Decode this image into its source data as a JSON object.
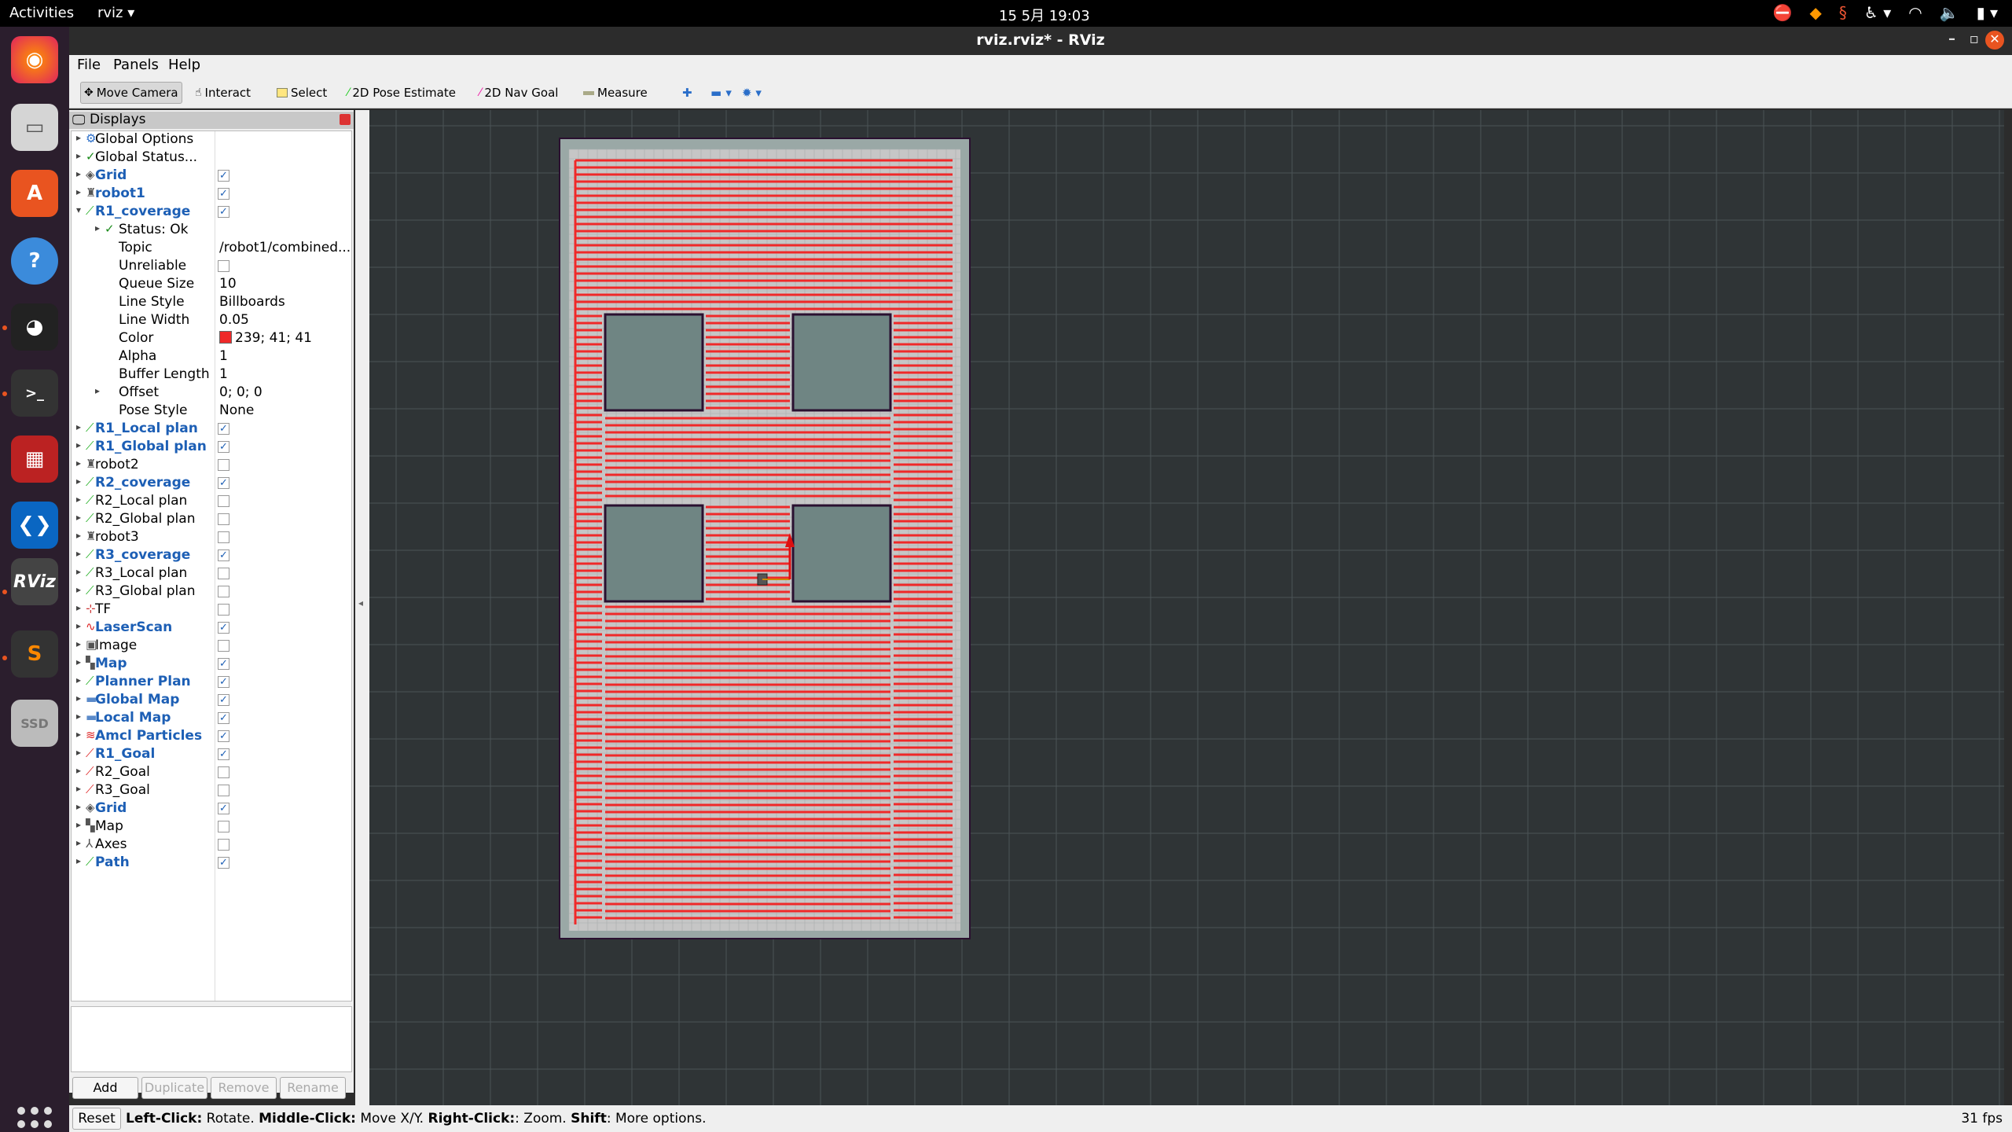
{
  "topbar": {
    "activities": "Activities",
    "app_name": "rviz",
    "clock": "15 5月  19:03"
  },
  "window": {
    "title": "rviz.rviz* - RViz"
  },
  "menu": {
    "file": "File",
    "panels": "Panels",
    "help": "Help"
  },
  "toolbar": {
    "move_camera": "Move Camera",
    "interact": "Interact",
    "select": "Select",
    "pose_estimate": "2D Pose Estimate",
    "nav_goal": "2D Nav Goal",
    "measure": "Measure"
  },
  "displays": {
    "title": "Displays",
    "rows": [
      {
        "label": "Global Options",
        "depth": 0,
        "icon": "gear-icon"
      },
      {
        "label": "Global Status...",
        "depth": 0,
        "icon": "check-icon"
      },
      {
        "label": "Grid",
        "depth": 0,
        "icon": "grid-icon",
        "bold": true,
        "checked": true
      },
      {
        "label": "robot1",
        "depth": 0,
        "icon": "robot-icon",
        "bold": true,
        "checked": true
      },
      {
        "label": "R1_coverage",
        "depth": 0,
        "icon": "path-icon",
        "bold": true,
        "checked": true,
        "expanded": true
      },
      {
        "label": "Status: Ok",
        "depth": 1,
        "icon": "check-icon"
      },
      {
        "label": "Topic",
        "depth": 1,
        "value": "/robot1/combined..."
      },
      {
        "label": "Unreliable",
        "depth": 1,
        "checked": false
      },
      {
        "label": "Queue Size",
        "depth": 1,
        "value": "10"
      },
      {
        "label": "Line Style",
        "depth": 1,
        "value": "Billboards"
      },
      {
        "label": "Line Width",
        "depth": 1,
        "value": "0.05"
      },
      {
        "label": "Color",
        "depth": 1,
        "value": "239; 41; 41",
        "swatch": "#ef2929"
      },
      {
        "label": "Alpha",
        "depth": 1,
        "value": "1"
      },
      {
        "label": "Buffer Length",
        "depth": 1,
        "value": "1"
      },
      {
        "label": "Offset",
        "depth": 1,
        "value": "0; 0; 0",
        "collapsible": true
      },
      {
        "label": "Pose Style",
        "depth": 1,
        "value": "None"
      },
      {
        "label": "R1_Local plan",
        "depth": 0,
        "icon": "path-icon",
        "bold": true,
        "checked": true
      },
      {
        "label": "R1_Global plan",
        "depth": 0,
        "icon": "path-icon",
        "bold": true,
        "checked": true
      },
      {
        "label": "robot2",
        "depth": 0,
        "icon": "robot-icon",
        "checked": false
      },
      {
        "label": "R2_coverage",
        "depth": 0,
        "icon": "path-icon",
        "bold": true,
        "checked": true
      },
      {
        "label": "R2_Local plan",
        "depth": 0,
        "icon": "path-icon",
        "checked": false
      },
      {
        "label": "R2_Global plan",
        "depth": 0,
        "icon": "path-icon",
        "checked": false
      },
      {
        "label": "robot3",
        "depth": 0,
        "icon": "robot-icon",
        "checked": false
      },
      {
        "label": "R3_coverage",
        "depth": 0,
        "icon": "path-icon",
        "bold": true,
        "checked": true
      },
      {
        "label": "R3_Local plan",
        "depth": 0,
        "icon": "path-icon",
        "checked": false
      },
      {
        "label": "R3_Global plan",
        "depth": 0,
        "icon": "path-icon",
        "checked": false
      },
      {
        "label": "TF",
        "depth": 0,
        "icon": "tf-icon",
        "checked": false
      },
      {
        "label": "LaserScan",
        "depth": 0,
        "icon": "laser-icon",
        "bold": true,
        "checked": true
      },
      {
        "label": "Image",
        "depth": 0,
        "icon": "image-icon",
        "checked": false
      },
      {
        "label": "Map",
        "depth": 0,
        "icon": "map-icon",
        "bold": true,
        "checked": true
      },
      {
        "label": "Planner Plan",
        "depth": 0,
        "icon": "path-icon",
        "bold": true,
        "checked": true
      },
      {
        "label": "Global Map",
        "depth": 0,
        "icon": "folder-icon",
        "bold": true,
        "checked": true
      },
      {
        "label": "Local Map",
        "depth": 0,
        "icon": "folder-icon",
        "bold": true,
        "checked": true
      },
      {
        "label": "Amcl Particles",
        "depth": 0,
        "icon": "particles-icon",
        "bold": true,
        "checked": true
      },
      {
        "label": "R1_Goal",
        "depth": 0,
        "icon": "pose-icon",
        "bold": true,
        "checked": true
      },
      {
        "label": "R2_Goal",
        "depth": 0,
        "icon": "pose-icon",
        "checked": false
      },
      {
        "label": "R3_Goal",
        "depth": 0,
        "icon": "pose-icon",
        "checked": false
      },
      {
        "label": "Grid",
        "depth": 0,
        "icon": "grid-icon",
        "bold": true,
        "checked": true
      },
      {
        "label": "Map",
        "depth": 0,
        "icon": "map-icon",
        "checked": false
      },
      {
        "label": "Axes",
        "depth": 0,
        "icon": "axes-icon",
        "checked": false
      },
      {
        "label": "Path",
        "depth": 0,
        "icon": "path-icon",
        "bold": true,
        "checked": true
      }
    ],
    "buttons": {
      "add": "Add",
      "duplicate": "Duplicate",
      "remove": "Remove",
      "rename": "Rename"
    }
  },
  "statusbar": {
    "reset": "Reset",
    "hint_left_click": "Left-Click:",
    "hint_rotate": " Rotate. ",
    "hint_middle_click": "Middle-Click:",
    "hint_move": " Move X/Y. ",
    "hint_right_click": "Right-Click:",
    "hint_zoom": ": Zoom. ",
    "hint_shift": "Shift",
    "hint_more": ": More options.",
    "fps": "31 fps"
  },
  "colors": {
    "path": "#ef2929",
    "map_free": "#c6c6c6",
    "map_unknown": "#6f8583",
    "map_wall": "#2a1030",
    "background": "#2f3436",
    "accent": "#e95420"
  }
}
